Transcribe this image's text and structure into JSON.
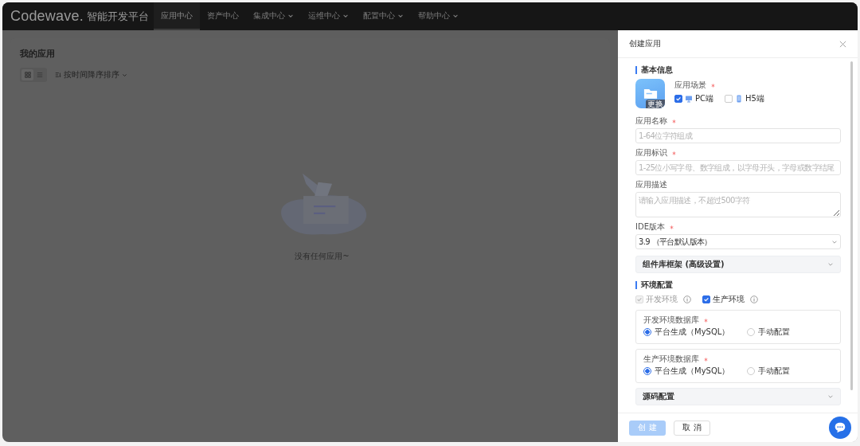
{
  "nav": {
    "logo": "Codewave.",
    "logo_suffix": "智能开发平台",
    "items": [
      {
        "label": "应用中心",
        "selected": true,
        "dropdown": false
      },
      {
        "label": "资产中心",
        "selected": false,
        "dropdown": false
      },
      {
        "label": "集成中心",
        "selected": false,
        "dropdown": true
      },
      {
        "label": "运维中心",
        "selected": false,
        "dropdown": true
      },
      {
        "label": "配置中心",
        "selected": false,
        "dropdown": true
      },
      {
        "label": "帮助中心",
        "selected": false,
        "dropdown": true
      }
    ]
  },
  "page": {
    "title": "我的应用",
    "views": [
      {
        "kind": "grid",
        "selected": true
      },
      {
        "kind": "list",
        "selected": false
      }
    ],
    "sort": "按时间降序排序",
    "empty_text": "没有任何应用~"
  },
  "drawer": {
    "title": "创建应用",
    "basic": {
      "title": "基本信息",
      "icon_badge": "更换",
      "scene_label": "应用场景",
      "scene_required": true,
      "scenes": [
        {
          "kind": "monitor",
          "label": "PC端",
          "checked": true
        },
        {
          "kind": "phone",
          "label": "H5端",
          "checked": false
        }
      ]
    },
    "fields": [
      {
        "kind": "input",
        "label": "应用名称",
        "required": true,
        "placeholder": "1-64位字符组成"
      },
      {
        "kind": "input",
        "label": "应用标识",
        "required": true,
        "placeholder": "1-25位小写字母、数字组成，以字母开头，字母或数字结尾"
      },
      {
        "kind": "textarea",
        "label": "应用描述",
        "required": false,
        "placeholder": "请输入应用描述，不超过500字符"
      },
      {
        "kind": "select",
        "label": "IDE版本",
        "required": true,
        "value": "3.9 （平台默认版本）"
      },
      {
        "kind": "collapse",
        "label": "组件库框架 (高级设置)",
        "expanded": false
      }
    ],
    "env": {
      "title": "环境配置",
      "envs": [
        {
          "label": "开发环境",
          "checked": true,
          "disabled": true
        },
        {
          "label": "生产环境",
          "checked": true,
          "disabled": false
        }
      ],
      "databases": [
        {
          "label": "开发环境数据库",
          "required": true,
          "options": [
            {
              "label": "平台生成（MySQL）",
              "selected": true
            },
            {
              "label": "手动配置",
              "selected": false
            }
          ]
        },
        {
          "label": "生产环境数据库",
          "required": true,
          "options": [
            {
              "label": "平台生成（MySQL）",
              "selected": true
            },
            {
              "label": "手动配置",
              "selected": false
            }
          ]
        }
      ],
      "source": {
        "label": "源码配置",
        "expanded": false
      }
    },
    "buttons": [
      {
        "kind": "primary",
        "label": "创 建",
        "disabled": true
      },
      {
        "kind": "default",
        "label": "取 消",
        "disabled": false
      }
    ]
  }
}
